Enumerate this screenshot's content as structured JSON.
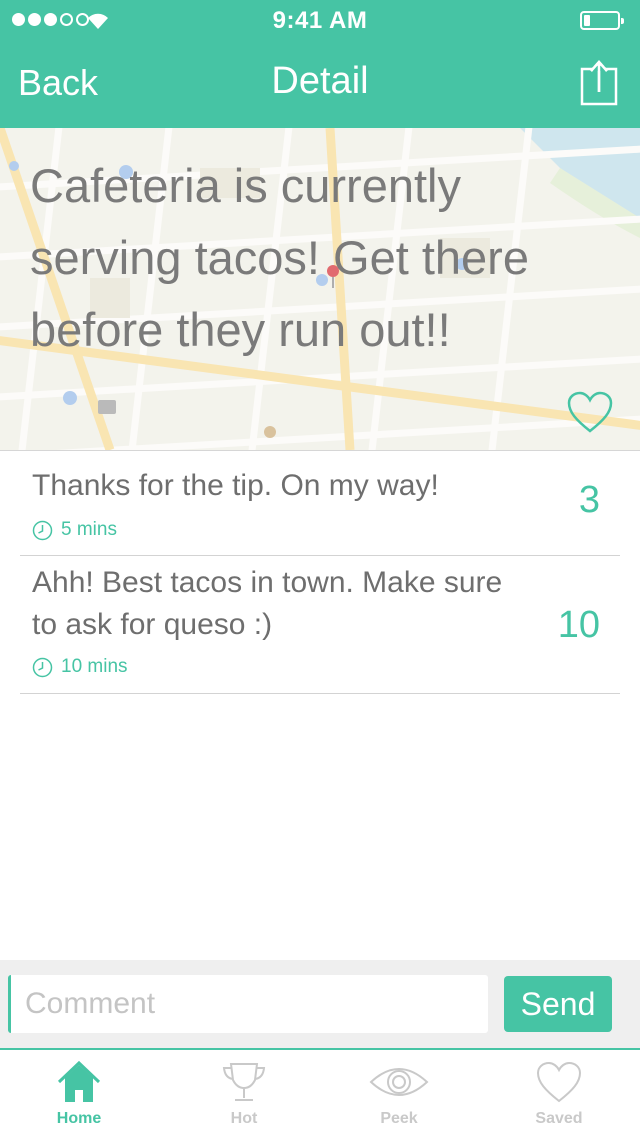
{
  "status_bar": {
    "time": "9:41 AM"
  },
  "nav": {
    "back_label": "Back",
    "title": "Detail"
  },
  "post": {
    "text": "Cafeteria is currently serving tacos! Get there before they run out!!"
  },
  "replies": [
    {
      "text": "Thanks for the tip. On my way!",
      "time": "5 mins",
      "score": "3"
    },
    {
      "text": "Ahh! Best tacos in town. Make sure to ask for queso :)",
      "time": "10 mins",
      "score": "10"
    }
  ],
  "comment": {
    "placeholder": "Comment",
    "value": "",
    "send_label": "Send"
  },
  "tabs": [
    {
      "label": "Home",
      "icon": "home-icon",
      "active": true
    },
    {
      "label": "Hot",
      "icon": "trophy-icon",
      "active": false
    },
    {
      "label": "Peek",
      "icon": "eye-icon",
      "active": false
    },
    {
      "label": "Saved",
      "icon": "heart-icon",
      "active": false
    }
  ],
  "colors": {
    "accent": "#46c4a4",
    "text": "#7a7a7a",
    "inactive_tab": "#c9c9c9"
  }
}
